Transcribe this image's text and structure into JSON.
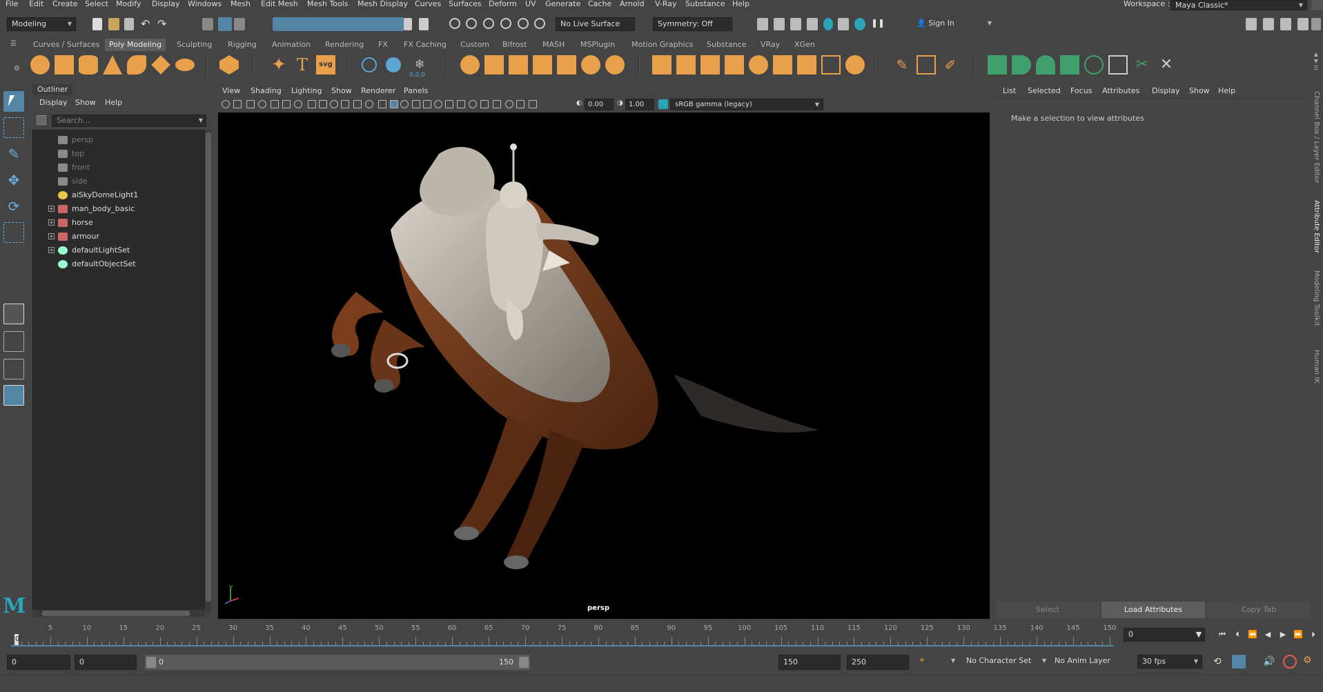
{
  "menubar": {
    "items": [
      "File",
      "Edit",
      "Create",
      "Select",
      "Modify",
      "Display",
      "Windows",
      "Mesh",
      "Edit Mesh",
      "Mesh Tools",
      "Mesh Display",
      "Curves",
      "Surfaces",
      "Deform",
      "UV",
      "Generate",
      "Cache",
      "Arnold",
      "V-Ray",
      "Substance",
      "Help"
    ],
    "workspace_label": "Workspace :",
    "workspace_value": "Maya Classic*"
  },
  "statusline": {
    "mode": "Modeling",
    "live_surface": "No Live Surface",
    "symmetry": "Symmetry: Off",
    "sign_in": "Sign In"
  },
  "shelf": {
    "tabs": [
      "Curves / Surfaces",
      "Poly Modeling",
      "Sculpting",
      "Rigging",
      "Animation",
      "Rendering",
      "FX",
      "FX Caching",
      "Custom",
      "Bifrost",
      "MASH",
      "MSPlugin",
      "Motion Graphics",
      "Substance",
      "VRay",
      "XGen"
    ],
    "active_tab": "Poly Modeling",
    "svg_label": "svg",
    "text_label": "T",
    "coord_label": "0,0,0"
  },
  "outliner": {
    "title": "Outliner",
    "menu": [
      "Display",
      "Show",
      "Help"
    ],
    "search_placeholder": "Search...",
    "items": [
      {
        "label": "persp",
        "dim": true,
        "expandable": false,
        "icon": "camera-icon"
      },
      {
        "label": "top",
        "dim": true,
        "expandable": false,
        "icon": "camera-icon"
      },
      {
        "label": "front",
        "dim": true,
        "expandable": false,
        "icon": "camera-icon"
      },
      {
        "label": "side",
        "dim": true,
        "expandable": false,
        "icon": "camera-icon"
      },
      {
        "label": "aiSkyDomeLight1",
        "dim": false,
        "expandable": false,
        "icon": "skydome-light-icon"
      },
      {
        "label": "man_body_basic",
        "dim": false,
        "expandable": true,
        "icon": "mesh-icon"
      },
      {
        "label": "horse",
        "dim": false,
        "expandable": true,
        "icon": "mesh-icon"
      },
      {
        "label": "armour",
        "dim": false,
        "expandable": true,
        "icon": "mesh-icon"
      },
      {
        "label": "defaultLightSet",
        "dim": false,
        "expandable": true,
        "icon": "set-icon"
      },
      {
        "label": "defaultObjectSet",
        "dim": false,
        "expandable": false,
        "icon": "set-icon"
      }
    ]
  },
  "viewport": {
    "menu": [
      "View",
      "Shading",
      "Lighting",
      "Show",
      "Renderer",
      "Panels"
    ],
    "exposure": "0.00",
    "gamma": "1.00",
    "color_space": "sRGB gamma (legacy)",
    "camera_label": "persp",
    "axis_y": "y"
  },
  "attribute_editor": {
    "menu": [
      "List",
      "Selected",
      "Focus",
      "Attributes",
      "Display",
      "Show",
      "Help"
    ],
    "message": "Make a selection to view attributes",
    "buttons": {
      "select": "Select",
      "load": "Load Attributes",
      "copy": "Copy Tab"
    }
  },
  "side_tabs": [
    "Channel Box / Layer Editor",
    "Attribute Editor",
    "Modeling Toolkit",
    "Human IK"
  ],
  "timeslider": {
    "ticks": [
      "5",
      "10",
      "15",
      "20",
      "25",
      "30",
      "35",
      "40",
      "45",
      "50",
      "55",
      "60",
      "65",
      "70",
      "75",
      "80",
      "85",
      "90",
      "95",
      "100",
      "105",
      "110",
      "115",
      "120",
      "125",
      "130",
      "135",
      "140",
      "145",
      "150"
    ],
    "start_marker": "0",
    "current_frame": "0"
  },
  "rangebar": {
    "start": "0",
    "anim_start": "0",
    "range_min": "0",
    "range_max": "150",
    "end": "150",
    "anim_end": "250",
    "character_set": "No Character Set",
    "anim_layer": "No Anim Layer",
    "fps": "30 fps"
  },
  "colors": {
    "accent": "#5285a6",
    "shelf_orange": "#e8a04a",
    "shelf_green": "#3fa06b",
    "keyframe_red": "#e85a4f"
  }
}
